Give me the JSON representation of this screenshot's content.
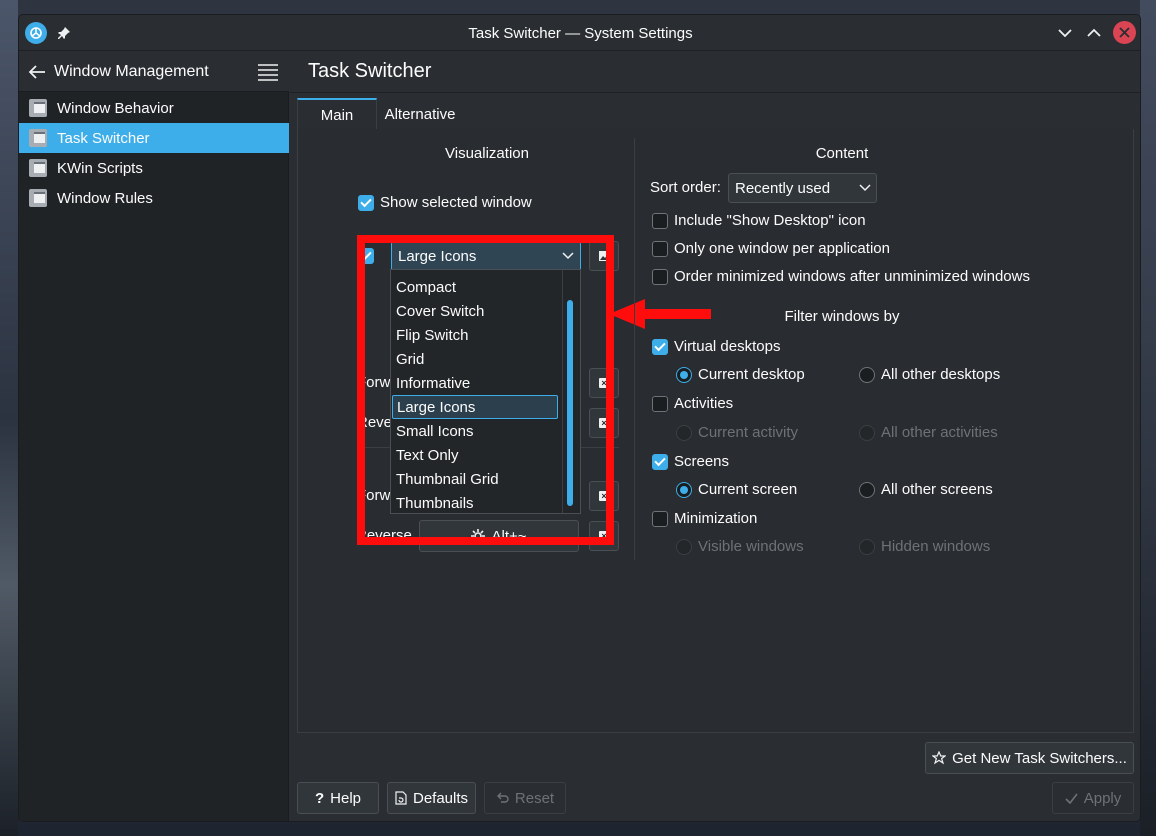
{
  "window": {
    "title": "Task Switcher — System Settings"
  },
  "sidebar": {
    "header": "Window Management",
    "items": [
      {
        "label": "Window Behavior",
        "active": false
      },
      {
        "label": "Task Switcher",
        "active": true
      },
      {
        "label": "KWin Scripts",
        "active": false
      },
      {
        "label": "Window Rules",
        "active": false
      }
    ]
  },
  "page": {
    "title": "Task Switcher"
  },
  "tabs": [
    {
      "label": "Main",
      "active": true
    },
    {
      "label": "Alternative",
      "active": false
    }
  ],
  "visualization": {
    "title": "Visualization",
    "show_selected_window": {
      "label": "Show selected window",
      "checked": true
    },
    "effect_enabled": true,
    "effect_combo": "Large Icons",
    "dropdown_options": [
      "Compact",
      "Cover Switch",
      "Flip Switch",
      "Grid",
      "Informative",
      "Large Icons",
      "Small Icons",
      "Text Only",
      "Thumbnail Grid",
      "Thumbnails"
    ],
    "selected_option": "Large Icons",
    "shortcut_labels": [
      "Forw",
      "Reve",
      "Forw",
      "Reverse"
    ],
    "reverse_shortcut": "Alt+~"
  },
  "content": {
    "title": "Content",
    "sort_order_label": "Sort order:",
    "sort_order_value": "Recently used",
    "include_show_desktop": "Include \"Show Desktop\" icon",
    "one_window_per_app": "Only one window per application",
    "order_minimized": "Order minimized windows after unminimized windows",
    "filter_title": "Filter windows by",
    "virtual_desktops": "Virtual desktops",
    "current_desktop": "Current desktop",
    "all_other_desktops": "All other desktops",
    "activities": "Activities",
    "current_activity": "Current activity",
    "all_other_activities": "All other activities",
    "screens": "Screens",
    "current_screen": "Current screen",
    "all_other_screens": "All other screens",
    "minimization": "Minimization",
    "visible_windows": "Visible windows",
    "hidden_windows": "Hidden windows"
  },
  "buttons": {
    "get_new": "Get New Task Switchers...",
    "help": "Help",
    "defaults": "Defaults",
    "reset": "Reset",
    "apply": "Apply"
  },
  "colors": {
    "accent": "#3daee9",
    "annotation": "#ff0d0d",
    "close": "#da4453"
  }
}
